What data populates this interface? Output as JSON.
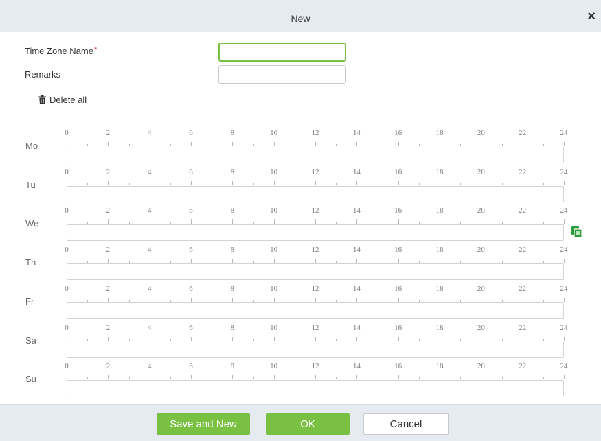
{
  "dialog": {
    "title": "New"
  },
  "form": {
    "time_zone_name_label": "Time Zone Name",
    "required_mark": "*",
    "time_zone_name_value": "",
    "remarks_label": "Remarks",
    "remarks_value": ""
  },
  "toolbar": {
    "delete_all_label": "Delete all"
  },
  "schedule": {
    "hour_labels": [
      "0",
      "2",
      "4",
      "6",
      "8",
      "10",
      "12",
      "14",
      "16",
      "18",
      "20",
      "22",
      "24"
    ],
    "days": [
      {
        "label": "Mo"
      },
      {
        "label": "Tu"
      },
      {
        "label": "We"
      },
      {
        "label": "Th"
      },
      {
        "label": "Fr"
      },
      {
        "label": "Sa"
      },
      {
        "label": "Su"
      }
    ],
    "copy_icon_day": "We"
  },
  "footer": {
    "save_and_new_label": "Save and New",
    "ok_label": "OK",
    "cancel_label": "Cancel"
  },
  "colors": {
    "accent": "#7ac143",
    "header_bg": "#e5ebf0",
    "required": "#e0282e"
  },
  "icons": {
    "close": "close-icon",
    "delete": "trash-icon",
    "copy": "copy-icon"
  }
}
